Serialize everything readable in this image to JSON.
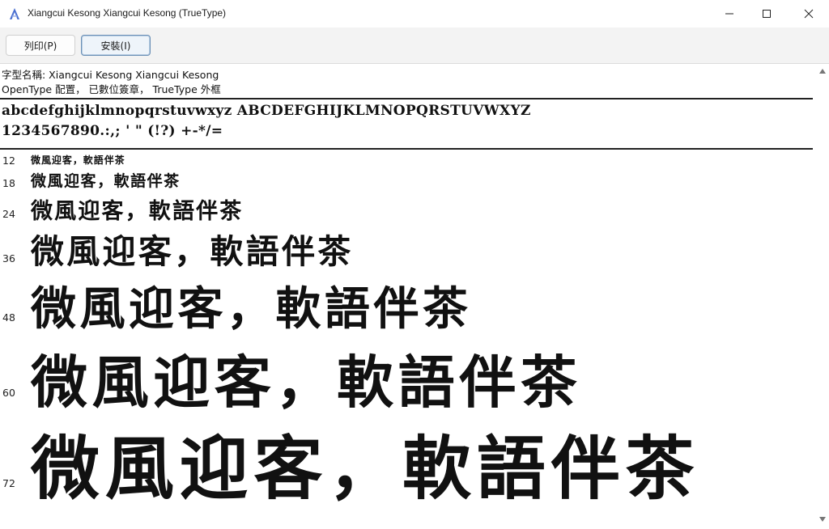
{
  "window": {
    "title": "Xiangcui Kesong Xiangcui Kesong (TrueType)",
    "icons": {
      "app": "font-app-icon",
      "minimize": "minimize-icon",
      "maximize": "maximize-icon",
      "close": "close-icon"
    }
  },
  "toolbar": {
    "print_label": "列印(P)",
    "install_label": "安裝(I)"
  },
  "info": {
    "font_name_line": "字型名稱: Xiangcui Kesong Xiangcui Kesong",
    "meta_line": "OpenType 配置， 已數位簽章， TrueType 外框"
  },
  "samples": {
    "alphabet_line": "abcdefghijklmnopqrstuvwxyz ABCDEFGHIJKLMNOPQRSTUVWXYZ",
    "digits_line": "1234567890.:,; ' \" (!?) +-*/="
  },
  "preview": {
    "text": "微風迎客，軟語伴茶",
    "sizes": [
      "12",
      "18",
      "24",
      "36",
      "48",
      "60",
      "72"
    ]
  }
}
